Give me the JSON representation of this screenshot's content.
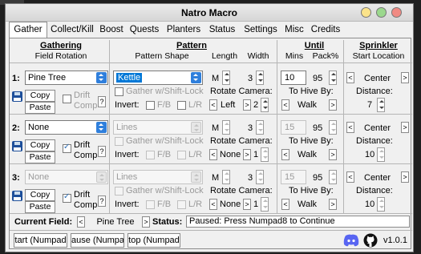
{
  "window": {
    "title": "Natro Macro",
    "version": "v1.0.1"
  },
  "tabs": [
    "Gather",
    "Collect/Kill",
    "Boost",
    "Quests",
    "Planters",
    "Status",
    "Settings",
    "Misc",
    "Credits"
  ],
  "headers": {
    "gathering": "Gathering",
    "field_rotation": "Field Rotation",
    "pattern": "Pattern",
    "pattern_shape": "Pattern Shape",
    "length": "Length",
    "width": "Width",
    "until": "Until",
    "mins": "Mins",
    "pack": "Pack%",
    "sprinkler": "Sprinkler",
    "start_location": "Start Location"
  },
  "labels": {
    "copy": "Copy",
    "paste": "Paste",
    "drift": "Drift",
    "comp": "Comp",
    "help": "?",
    "gather_shift": "Gather w/Shift-Lock",
    "invert": "Invert:",
    "fb": "F/B",
    "lr": "L/R",
    "rotate_camera": "Rotate Camera:",
    "to_hive_by": "To Hive By:",
    "distance": "Distance:",
    "arrow_left": "<",
    "arrow_right": ">"
  },
  "rows": [
    {
      "num": "1:",
      "field": "Pine Tree",
      "pattern": "Kettle",
      "length": "M",
      "width": "3",
      "rotate_dir": "Left",
      "rotate_count": "2",
      "mins": "10",
      "pack": "95",
      "hive_by": "Walk",
      "start_location": "Center",
      "distance": "7"
    },
    {
      "num": "2:",
      "field": "None",
      "pattern": "Lines",
      "length": "M",
      "width": "3",
      "rotate_dir": "None",
      "rotate_count": "1",
      "mins": "15",
      "pack": "95",
      "hive_by": "Walk",
      "start_location": "Center",
      "distance": "10"
    },
    {
      "num": "3:",
      "field": "None",
      "pattern": "Lines",
      "length": "M",
      "width": "3",
      "rotate_dir": "None",
      "rotate_count": "1",
      "mins": "15",
      "pack": "95",
      "hive_by": "Walk",
      "start_location": "Center",
      "distance": "10"
    }
  ],
  "footer": {
    "current_field_label": "Current Field:",
    "current_field": "Pine Tree",
    "status_label": "Status:",
    "status": "Paused: Press Numpad8 to Continue"
  },
  "bottom_buttons": {
    "start": "tart (Numpad",
    "pause": "ause (Numpad",
    "stop": "top (Numpad"
  },
  "icons": [
    "save-disk-icon",
    "discord-icon",
    "github-icon",
    "minimize-icon",
    "maximize-icon",
    "close-icon"
  ]
}
